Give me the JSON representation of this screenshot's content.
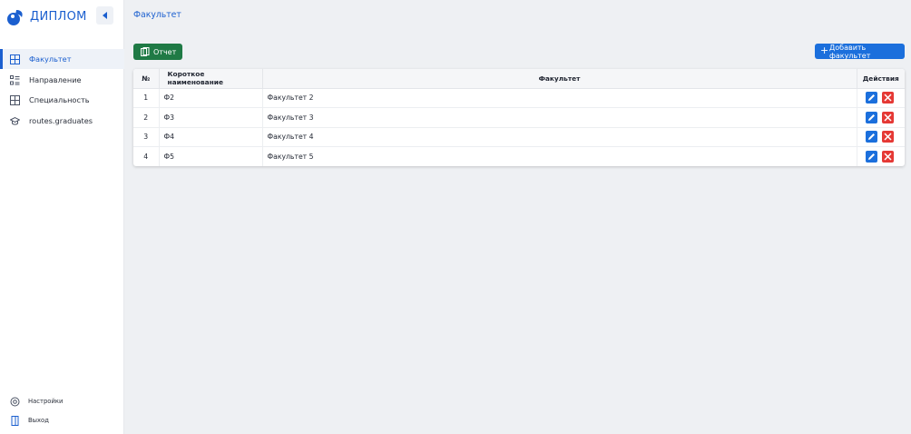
{
  "app": {
    "logo_text": "ДИПЛОМ",
    "brand_color": "#1b5fcf"
  },
  "sidebar": {
    "items": [
      {
        "label": "Факультет",
        "icon": "grid-icon",
        "active": true
      },
      {
        "label": "Направление",
        "icon": "list-icon",
        "active": false
      },
      {
        "label": "Специальность",
        "icon": "grid-icon",
        "active": false
      },
      {
        "label": "routes.graduates",
        "icon": "graduation-cap-icon",
        "active": false
      }
    ],
    "settings_label": "Настройки",
    "logout_label": "Выход"
  },
  "main": {
    "title": "Факультет",
    "report_label": "Отчет",
    "add_label": "Добавить факультет"
  },
  "table": {
    "headers": {
      "num": "№",
      "short": "Короткое наименование",
      "faculty": "Факультет",
      "actions": "Действия"
    },
    "rows": [
      {
        "num": "1",
        "short": "Ф2",
        "faculty": "Факультет 2"
      },
      {
        "num": "2",
        "short": "Ф3",
        "faculty": "Факультет 3"
      },
      {
        "num": "3",
        "short": "Ф4",
        "faculty": "Факультет 4"
      },
      {
        "num": "4",
        "short": "Ф5",
        "faculty": "Факультет 5"
      }
    ]
  },
  "colors": {
    "report_button": "#1f7a45",
    "add_button": "#1b6fdc",
    "edit_button": "#1b6fdc",
    "delete_button": "#e53935"
  }
}
